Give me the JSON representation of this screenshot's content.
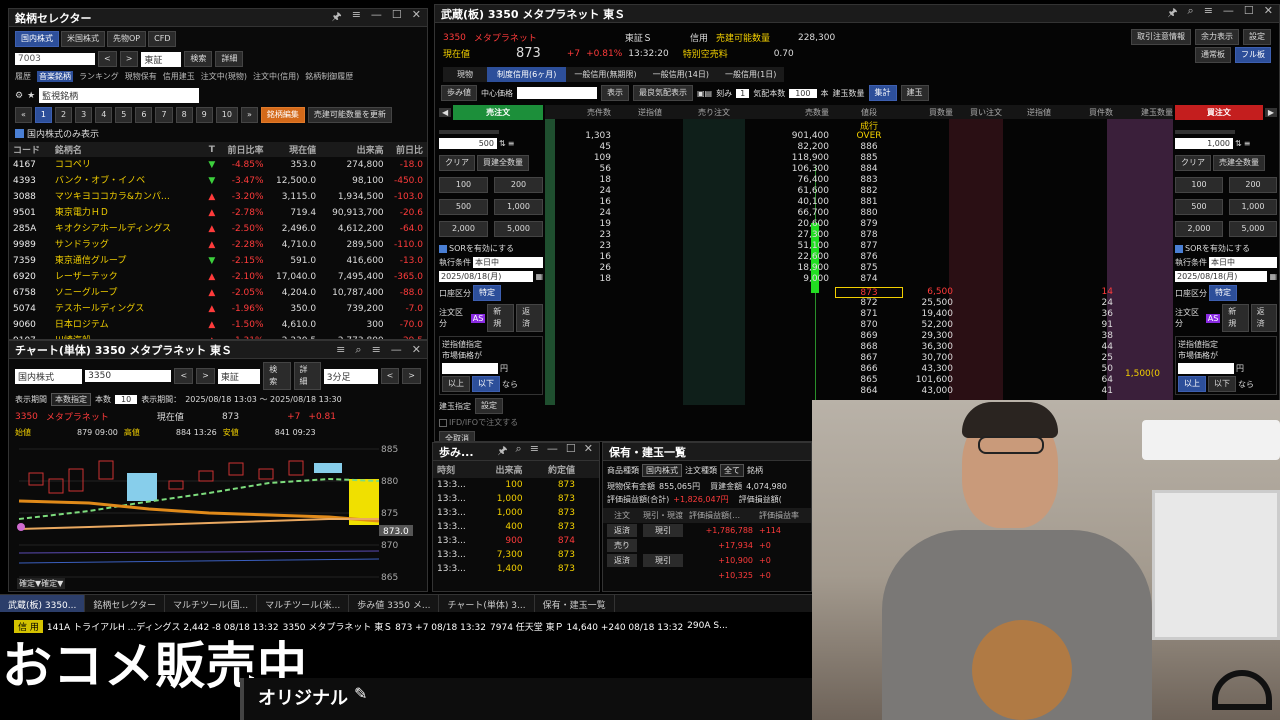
{
  "selector": {
    "title": "銘柄セレクター",
    "tabs": [
      "国内株式",
      "米国株式",
      "先物OP",
      "CFD"
    ],
    "code": "7003",
    "market": "東証",
    "btn_search": "検索",
    "btn_detail": "詳細",
    "subtabs": [
      "履歴",
      "音楽銘柄",
      "ランキング",
      "現物保有",
      "信用建玉",
      "注文中(現物)",
      "注文中(信用)",
      "銘柄制御履歴"
    ],
    "watchlist": "監視銘柄",
    "pages": [
      "1",
      "2",
      "3",
      "4",
      "5",
      "6",
      "7",
      "8",
      "9",
      "10"
    ],
    "btn_edit": "銘柄編集",
    "btn_update": "売建可能数量を更新",
    "checkbox": "国内株式のみ表示",
    "headers": [
      "コード",
      "銘柄名",
      "T",
      "前日比率",
      "現在値",
      "出来高",
      "前日比"
    ],
    "rows": [
      [
        "4167",
        "ココペリ",
        "▼",
        "-4.85%",
        "353.0",
        "274,800",
        "-18.0"
      ],
      [
        "4393",
        "バンク・オブ・イノベ",
        "▼",
        "-3.47%",
        "12,500.0",
        "98,100",
        "-450.0"
      ],
      [
        "3088",
        "マツキヨココカラ&カンパ…",
        "▲",
        "-3.20%",
        "3,115.0",
        "1,934,500",
        "-103.0"
      ],
      [
        "9501",
        "東京電力ＨＤ",
        "▲",
        "-2.78%",
        "719.4",
        "90,913,700",
        "-20.6"
      ],
      [
        "285A",
        "キオクシアホールディングス",
        "▲",
        "-2.50%",
        "2,496.0",
        "4,612,200",
        "-64.0"
      ],
      [
        "9989",
        "サンドラッグ",
        "▲",
        "-2.28%",
        "4,710.0",
        "289,500",
        "-110.0"
      ],
      [
        "7359",
        "東京通信グループ",
        "▼",
        "-2.15%",
        "591.0",
        "416,600",
        "-13.0"
      ],
      [
        "6920",
        "レーザーテック",
        "▲",
        "-2.10%",
        "17,040.0",
        "7,495,400",
        "-365.0"
      ],
      [
        "6758",
        "ソニーグループ",
        "▲",
        "-2.05%",
        "4,204.0",
        "10,787,400",
        "-88.0"
      ],
      [
        "5074",
        "テスホールディングス",
        "▲",
        "-1.96%",
        "350.0",
        "739,200",
        "-7.0"
      ],
      [
        "9060",
        "日本ロジテム",
        "▲",
        "-1.50%",
        "4,610.0",
        "300",
        "-70.0"
      ],
      [
        "9107",
        "川崎汽船",
        "▲",
        "-1.31%",
        "2,230.5",
        "2,773,800",
        "-29.5"
      ]
    ]
  },
  "chart": {
    "title": "チャート(単体) 3350 メタプラネット 東Ｓ",
    "market_sel": "国内株式",
    "code": "3350",
    "exchange": "東証",
    "btn_search": "検索",
    "btn_detail": "詳細",
    "interval": "3分足",
    "period_label": "表示期間",
    "period_sel": "本数指定",
    "count_label": "本数",
    "count": "10",
    "range_label": "表示期間：",
    "range": "2025/08/18 13:03 ～ 2025/08/18 13:30",
    "code2": "3350",
    "name2": "メタプラネット",
    "price_label": "現在値",
    "price": "873",
    "change": "+7",
    "change_pct": "+0.81",
    "open_label": "始値",
    "open": "879 09:00",
    "high_label": "高値",
    "high": "884 13:26",
    "low_label": "安値",
    "low": "841 09:23",
    "axis": [
      "885",
      "880",
      "875",
      "870",
      "865"
    ],
    "last_tag": "873.0",
    "bottom_label": "確定▼確定▼"
  },
  "board": {
    "title": "武蔵(板) 3350 メタプラネット 東Ｓ",
    "code": "3350",
    "name": "メタプラネット",
    "price_label": "現在値",
    "price": "873",
    "change": "+7",
    "change_pct": "+0.81%",
    "time": "13:32:20",
    "exch": "東証Ｓ",
    "credit": "信用",
    "sellable_label": "売建可能数量",
    "sellable": "228,300",
    "special_label": "特別空売料",
    "special": "0.70",
    "right_btns": [
      "取引注意情報",
      "余力表示",
      "設定"
    ],
    "mode_btns": [
      "通常板",
      "フル板"
    ],
    "tabs": [
      "現物",
      "制度信用(6ヶ月)",
      "一般信用(無期限)",
      "一般信用(14日)",
      "一般信用(1日)"
    ],
    "toolbar": [
      "歩み値",
      "中心価格",
      "表示",
      "最良気配表示",
      "刻み",
      "1",
      "気配本数",
      "100",
      "本",
      "建玉数量",
      "集計",
      "建玉"
    ],
    "headers": [
      "売件数",
      "逆指値",
      "売り注文",
      "売数量",
      "値段",
      "買数量",
      "買い注文",
      "逆指値",
      "買件数",
      "建玉数量"
    ],
    "sell_rows": [
      [
        "1,303",
        "901,400",
        "OVER"
      ],
      [
        "45",
        "82,200",
        "886"
      ],
      [
        "109",
        "118,900",
        "885"
      ],
      [
        "56",
        "106,300",
        "884"
      ],
      [
        "18",
        "76,400",
        "883"
      ],
      [
        "24",
        "61,600",
        "882"
      ],
      [
        "16",
        "40,100",
        "881"
      ],
      [
        "24",
        "66,700",
        "880"
      ],
      [
        "19",
        "20,600",
        "879"
      ],
      [
        "23",
        "27,300",
        "878"
      ],
      [
        "23",
        "51,100",
        "877"
      ],
      [
        "16",
        "22,600",
        "876"
      ],
      [
        "26",
        "18,900",
        "875"
      ],
      [
        "18",
        "9,000",
        "874"
      ]
    ],
    "buy_rows": [
      [
        "873",
        "6,500",
        "14"
      ],
      [
        "872",
        "25,500",
        "24"
      ],
      [
        "871",
        "19,400",
        "36"
      ],
      [
        "870",
        "52,200",
        "91"
      ],
      [
        "869",
        "29,300",
        "38"
      ],
      [
        "868",
        "36,300",
        "44"
      ],
      [
        "867",
        "30,700",
        "25"
      ],
      [
        "866",
        "43,300",
        "50"
      ],
      [
        "865",
        "101,600",
        "64"
      ],
      [
        "864",
        "43,000",
        "41"
      ]
    ],
    "top_label": "成行",
    "hold_qty": "1,500(0",
    "sell_panel": {
      "title": "売注文",
      "qty": "500",
      "clear": "クリア",
      "all": "買建全数量",
      "qbtns": [
        "100",
        "200",
        "500",
        "1,000",
        "2,000",
        "5,000"
      ],
      "sor": "SORを有効にする",
      "exec_label": "執行条件",
      "exec": "本日中",
      "date": "2025/08/18(月)",
      "acct_label": "口座区分",
      "acct": "特定",
      "order_label": "注文区分",
      "as": "AS",
      "new": "新規",
      "close": "返済",
      "trigger_label": "逆指値指定",
      "market_label": "市場価格が",
      "yen": "円",
      "above": "以上",
      "below": "以下",
      "then": "なら",
      "pos_label": "建玉指定",
      "setting": "設定",
      "ifd": "IFD/IFOで注文する",
      "order_btn": "全取消"
    },
    "buy_panel": {
      "title": "買注文",
      "qty": "1,000",
      "clear": "クリア",
      "all": "売建全数量",
      "qbtns": [
        "100",
        "200",
        "500",
        "1,000",
        "2,000",
        "5,000"
      ],
      "sor": "SORを有効にする",
      "exec_label": "執行条件",
      "exec": "本日中",
      "date": "2025/08/18(月)",
      "acct_label": "口座区分",
      "acct": "特定",
      "order_label": "注文区分",
      "as": "AS",
      "new": "新規",
      "close": "返済",
      "trigger_label": "逆指値指定",
      "market_label": "市場価格が",
      "yen": "円",
      "above": "以上",
      "below": "以下",
      "then": "なら"
    }
  },
  "ticks": {
    "title": "歩み...",
    "headers": [
      "時刻",
      "出来高",
      "約定値"
    ],
    "rows": [
      [
        "13:3...",
        "100",
        "873"
      ],
      [
        "13:3...",
        "1,000",
        "873"
      ],
      [
        "13:3...",
        "1,000",
        "873"
      ],
      [
        "13:3...",
        "400",
        "873"
      ],
      [
        "13:3...",
        "900",
        "874"
      ],
      [
        "13:3...",
        "7,300",
        "873"
      ],
      [
        "13:3...",
        "1,400",
        "873"
      ]
    ]
  },
  "holdings": {
    "title": "保有・建玉一覧",
    "product_label": "商品種類",
    "product": "国内株式",
    "order_type_label": "注文種類",
    "order_type": "全て",
    "brand_label": "銘柄",
    "cash_label": "現物保有金額",
    "cash": "855,065円",
    "margin_label": "買建金額",
    "margin": "4,074,980",
    "pl_total_label": "評価損益額(合計)",
    "pl_total": "+1,826,047円",
    "pl_label": "評価損益額(",
    "headers": [
      "注文",
      "現引・現渡",
      "評価損益額(…",
      "評価損益率"
    ],
    "rows": [
      [
        "返済",
        "現引",
        "+1,786,788",
        "+114"
      ],
      [
        "売り",
        "",
        "+17,934",
        "+0"
      ],
      [
        "返済",
        "現引",
        "+10,900",
        "+0"
      ],
      [
        "",
        "",
        "+10,325",
        "+0"
      ]
    ]
  },
  "taskbar": [
    "武蔵(板) 3350...",
    "銘柄セレクター",
    "マルチツール(国...",
    "マルチツール(米...",
    "歩み値 3350 メ...",
    "チャート(単体) 3...",
    "保有・建玉一覧"
  ],
  "ticker": {
    "badge": "信 用",
    "items": [
      "141A トライアルH ...ディングス 2,442 -8 08/18 13:32",
      "3350 メタプラネット 東Ｓ 873 +7 08/18 13:32",
      "7974 任天堂 東Ｐ 14,640 +240 08/18 13:32",
      "290A S..."
    ]
  },
  "overlay": {
    "big_text": "おコメ販売中",
    "original": "オリジナル"
  },
  "colors": {
    "blue_btn": "#2d4f9a",
    "sell_header": "#1c8f3a",
    "buy_header": "#c41e1e",
    "up": "#3ccf3c",
    "down": "#ff3b3b"
  }
}
